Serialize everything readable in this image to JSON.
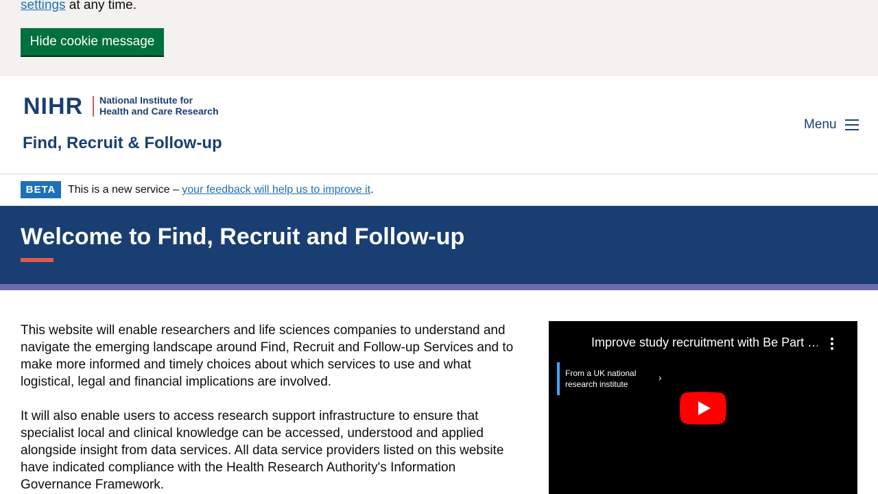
{
  "cookie": {
    "settings_link": "settings",
    "line_suffix": " at any time.",
    "hide_button": "Hide cookie message"
  },
  "header": {
    "logo_mark": "NIHR",
    "logo_line1": "National Institute for",
    "logo_line2": "Health and Care Research",
    "service_name": "Find, Recruit & Follow-up",
    "menu_label": "Menu",
    "brand_color": "#193e72",
    "accent_color": "#e05a49"
  },
  "beta": {
    "tag": "BETA",
    "text": "This is a new service – ",
    "link": "your feedback will help us to improve it",
    "suffix": "."
  },
  "hero": {
    "title": "Welcome to Find, Recruit and Follow-up",
    "background": "#193e72",
    "stripe_color": "#6c6bb0"
  },
  "main": {
    "paragraph1": "This website will enable researchers and life sciences companies to understand and navigate the emerging landscape around Find, Recruit and Follow-up Services and to make more informed and timely choices about which services to use and what logistical, legal and financial implications are involved.",
    "paragraph2": "It will also enable users to access research support infrastructure to ensure that specialist local and clinical knowledge can be accessed, understood and applied alongside insight from data services. All data service providers listed on this website have indicated compliance with the Health Research Authority's Information Governance Framework."
  },
  "video": {
    "title": "Improve study recruitment with Be Part …",
    "info_line": "From a UK national research institute",
    "more_icon": "kebab-menu-icon",
    "play_icon": "youtube-play-icon"
  }
}
